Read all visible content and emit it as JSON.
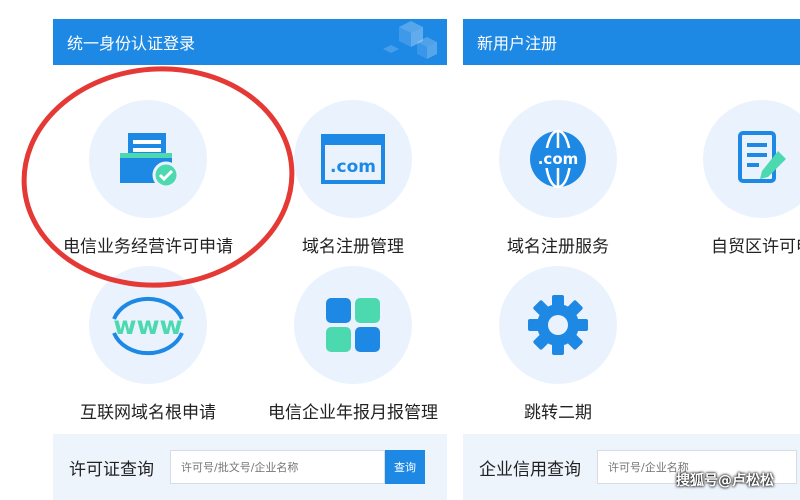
{
  "left_panel": {
    "title": "统一身份认证登录"
  },
  "right_panel": {
    "title": "新用户注册"
  },
  "tiles": [
    {
      "label": "电信业务经营许可申请",
      "icon": "license-form-icon"
    },
    {
      "label": "域名注册管理",
      "icon": "dotcom-browser-icon"
    },
    {
      "label": "域名注册服务",
      "icon": "dotcom-globe-icon"
    },
    {
      "label": "自贸区许可申",
      "icon": "document-edit-icon"
    },
    {
      "label": "互联网域名根申请",
      "icon": "www-icon"
    },
    {
      "label": "电信企业年报月报管理",
      "icon": "dashboard-tiles-icon"
    },
    {
      "label": "跳转二期",
      "icon": "gear-icon"
    }
  ],
  "query_left": {
    "label": "许可证查询",
    "placeholder": "许可号/批文号/企业名称",
    "button": "查询"
  },
  "query_right": {
    "label": "企业信用查询",
    "placeholder": "许可号/企业名称"
  },
  "icon_text": {
    "dotcom": ".com",
    "www": "www"
  },
  "watermark": "搜狐号@卢松松",
  "colors": {
    "brand": "#1e88e5",
    "accent_green": "#4dd9b0",
    "highlight": "#e53935",
    "tile_bg": "#eaf3fd"
  }
}
